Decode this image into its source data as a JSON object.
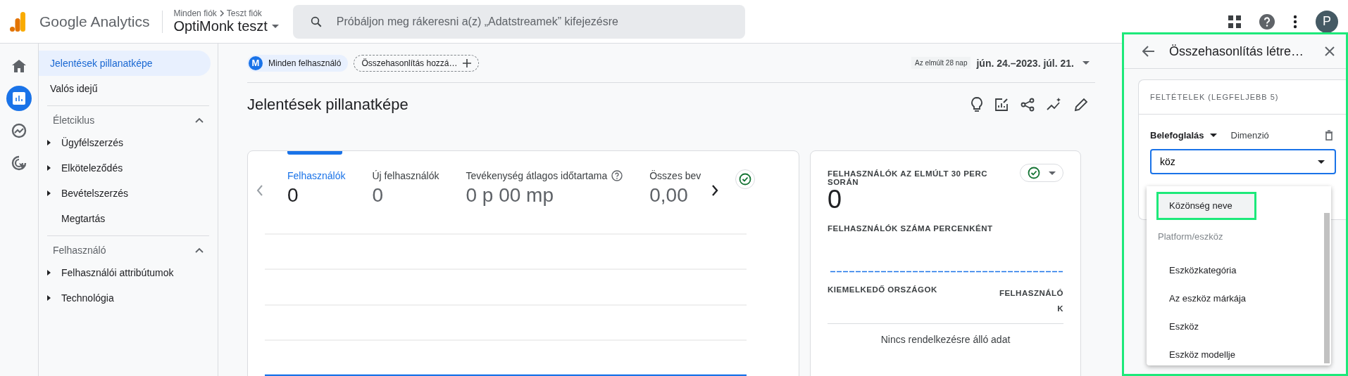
{
  "header": {
    "product": "Google Analytics",
    "breadcrumb": [
      "Minden fiók",
      "Teszt fiók"
    ],
    "property": "OptiMonk teszt",
    "search": {
      "placeholder": "Próbáljon meg rákeresni a(z) „Adatstreamek” kifejezésre"
    },
    "avatar": "P"
  },
  "rail": [
    {
      "kind": "home",
      "selected": false
    },
    {
      "kind": "reports",
      "selected": true
    },
    {
      "kind": "explore",
      "selected": false
    },
    {
      "kind": "advertising",
      "selected": false
    }
  ],
  "sidebar": {
    "items": [
      {
        "label": "Jelentések pillanatképe",
        "selected": true
      },
      {
        "label": "Valós idejű",
        "selected": false
      }
    ],
    "sections": [
      {
        "title": "Életciklus",
        "expanded": true,
        "items": [
          {
            "label": "Ügyfélszerzés",
            "expandable": true
          },
          {
            "label": "Elköteleződés",
            "expandable": true
          },
          {
            "label": "Bevételszerzés",
            "expandable": true
          },
          {
            "label": "Megtartás",
            "expandable": false
          }
        ]
      },
      {
        "title": "Felhasználó",
        "expanded": true,
        "items": [
          {
            "label": "Felhasználói attribútumok",
            "expandable": true
          },
          {
            "label": "Technológia",
            "expandable": true
          }
        ]
      }
    ]
  },
  "toolbar": {
    "segment": {
      "letter": "M",
      "label": "Minden felhasználó"
    },
    "compare_chip": "Összehasonlítás hozzá…",
    "date_badge": "Az elmúlt 28 nap",
    "date_range": "jún. 24.–2023. júl. 21."
  },
  "page_title": "Jelentések pillanatképe",
  "metrics_card": {
    "metrics": [
      {
        "label": "Felhasználók",
        "value": "0",
        "selected": true,
        "help": false
      },
      {
        "label": "Új felhasználók",
        "value": "0",
        "selected": false,
        "help": false
      },
      {
        "label": "Tevékenység átlagos időtartama",
        "value": "0 p 00 mp",
        "selected": false,
        "help": true
      },
      {
        "label": "Összes bev",
        "value": "0,00",
        "selected": false,
        "help": false
      }
    ]
  },
  "realtime_card": {
    "title": "FELHASZNÁLÓK AZ ELMÚLT 30 PERC SORÁN",
    "value": "0",
    "subtitle": "FELHASZNÁLÓK SZÁMA PERCENKÉNT",
    "columns": [
      "KIEMELKEDŐ ORSZÁGOK",
      "FELHASZNÁLÓK"
    ],
    "empty": "Nincs rendelkezésre álló adat"
  },
  "panel": {
    "title": "Összehasonlítás létre…",
    "conditions_title": "FELTÉTELEK (LEGFELJEBB 5)",
    "mode": "Belefoglalás",
    "field": "Dimenzió",
    "input": {
      "value": "köz"
    },
    "options": [
      {
        "kind": "option",
        "label": "Közönség neve",
        "selected": true
      },
      {
        "kind": "group",
        "label": "Platform/eszköz"
      },
      {
        "kind": "option",
        "label": "Eszközkategória",
        "selected": false
      },
      {
        "kind": "option",
        "label": "Az eszköz márkája",
        "selected": false
      },
      {
        "kind": "option",
        "label": "Eszköz",
        "selected": false
      },
      {
        "kind": "option",
        "label": "Eszköz modellje",
        "selected": false
      }
    ]
  }
}
